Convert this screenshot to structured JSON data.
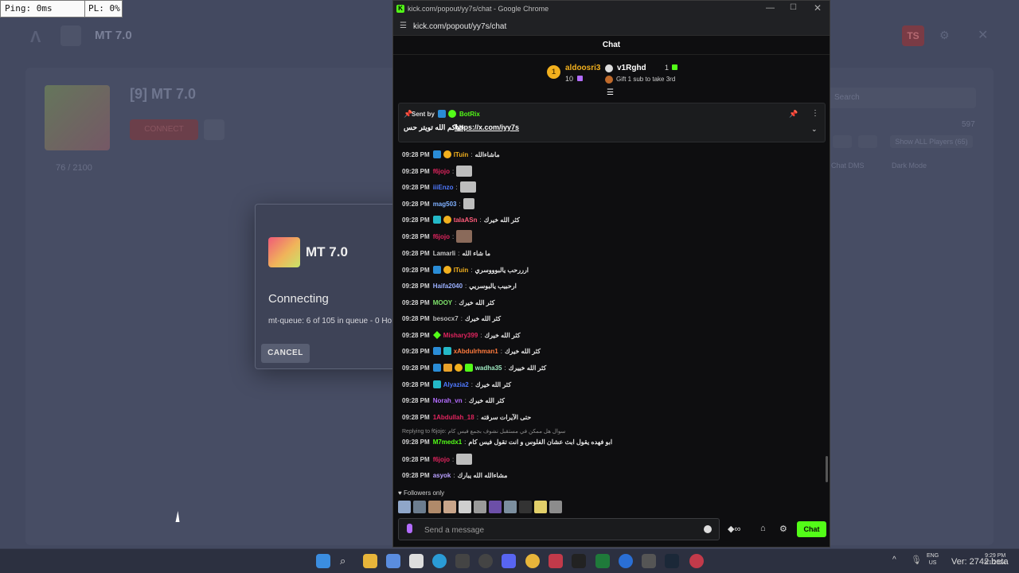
{
  "overlay": {
    "ping": "Ping: 0ms",
    "packet_loss": "PL: 0%"
  },
  "launcher": {
    "logo": "Λ",
    "title": "MT 7.0",
    "server_name": "[9] MT 7.0",
    "connect_label": "CONNECT",
    "players": "76 / 2100",
    "search_placeholder": "Search",
    "count": "597",
    "filter_label": "Show ALL Players (65)",
    "chat_label": "Chat DMS",
    "dark_label": "Dark Mode",
    "ts_label": "TS",
    "modal": {
      "app_name": "MT 7.0",
      "status": "Connecting",
      "queue": "mt-queue: 6 of 105 in queue - 0 Ho",
      "cancel_label": "CANCEL"
    }
  },
  "chrome": {
    "window_title": "kick.com/popout/yy7s/chat - Google Chrome",
    "url": "kick.com/popout/yy7s/chat"
  },
  "chat": {
    "title": "Chat",
    "leaderboard": {
      "first": {
        "rank": "1",
        "name": "aldoosri3",
        "count": "10"
      },
      "second": {
        "name": "v1Rghd",
        "count": "1"
      },
      "note": "Gift 1 sub to take 3rd"
    },
    "pinned": {
      "sent_by": "Sent by",
      "bot_name": "BotRix",
      "text": "حياكم الله تويتر حس",
      "link": "https://x.com/iyy7s"
    },
    "messages": [
      {
        "time": "09:28 PM",
        "user": "ITuin",
        "color": "#f2b01e",
        "text": "ماشاءالله"
      },
      {
        "time": "09:28 PM",
        "user": "f6jojo",
        "color": "#e0245e",
        "text": ""
      },
      {
        "time": "09:28 PM",
        "user": "iiiEnzo",
        "color": "#4f79ff",
        "text": ""
      },
      {
        "time": "09:28 PM",
        "user": "mag503",
        "color": "#7fb0ff",
        "text": ""
      },
      {
        "time": "09:28 PM",
        "user": "talaASn",
        "color": "#ff5b7a",
        "text": "كثر الله خيرك"
      },
      {
        "time": "09:28 PM",
        "user": "f6jojo",
        "color": "#e0245e",
        "text": ""
      },
      {
        "time": "09:28 PM",
        "user": "Lamarli",
        "color": "#c8c8c8",
        "text": "ما شاء الله"
      },
      {
        "time": "09:28 PM",
        "user": "ITuin",
        "color": "#f2b01e",
        "text": "ارررحب يالبوووسري"
      },
      {
        "time": "09:28 PM",
        "user": "Haifa2040",
        "color": "#9ab0ff",
        "text": "ارحبيب يالبوسريي"
      },
      {
        "time": "09:28 PM",
        "user": "MOOY",
        "color": "#7ee26a",
        "text": "كثر الله خيرك"
      },
      {
        "time": "09:28 PM",
        "user": "besocx7",
        "color": "#b9b9b9",
        "text": "كثر الله خيرك"
      },
      {
        "time": "09:28 PM",
        "user": "Mishary399",
        "color": "#e0245e",
        "text": "كثر الله خيرك"
      },
      {
        "time": "09:28 PM",
        "user": "xAbdulrhman1",
        "color": "#ff7a3d",
        "text": "كثر الله خيرك"
      },
      {
        "time": "09:28 PM",
        "user": "wadha35",
        "color": "#9ee8c0",
        "text": "كثر الله خييرك"
      },
      {
        "time": "09:28 PM",
        "user": "Alyazia2",
        "color": "#4f79ff",
        "text": "كثر الله خيرك"
      },
      {
        "time": "09:28 PM",
        "user": "Norah_vn",
        "color": "#b36cff",
        "text": "كثر الله خيرك"
      },
      {
        "time": "09:28 PM",
        "user": "1Abdullah_18",
        "color": "#e0245e",
        "text": "حتى الآيرات سرقته"
      },
      {
        "time": "09:28 PM",
        "user": "M7medx1",
        "color": "#53fc18",
        "text": "ابو فهده يقول ابث عشان الفلوس و انت تقول فيس كام",
        "reply": "Replying to f6jojo: سوال هل ممكن في مستقبل نشوف بجمع فيس كام"
      },
      {
        "time": "09:28 PM",
        "user": "f6jojo",
        "color": "#e0245e",
        "text": ""
      },
      {
        "time": "09:28 PM",
        "user": "asyok",
        "color": "#b9a0ff",
        "text": "مشاءالله الله يبارك"
      }
    ],
    "followers_only": "Followers only",
    "input_placeholder": "Send a message",
    "chat_button": "Chat"
  },
  "taskbar": {
    "lang1": "ENG",
    "lang2": "US",
    "time": "9:29 PM",
    "date": "3/1/2024",
    "version": "Ver: 2742 beta"
  }
}
